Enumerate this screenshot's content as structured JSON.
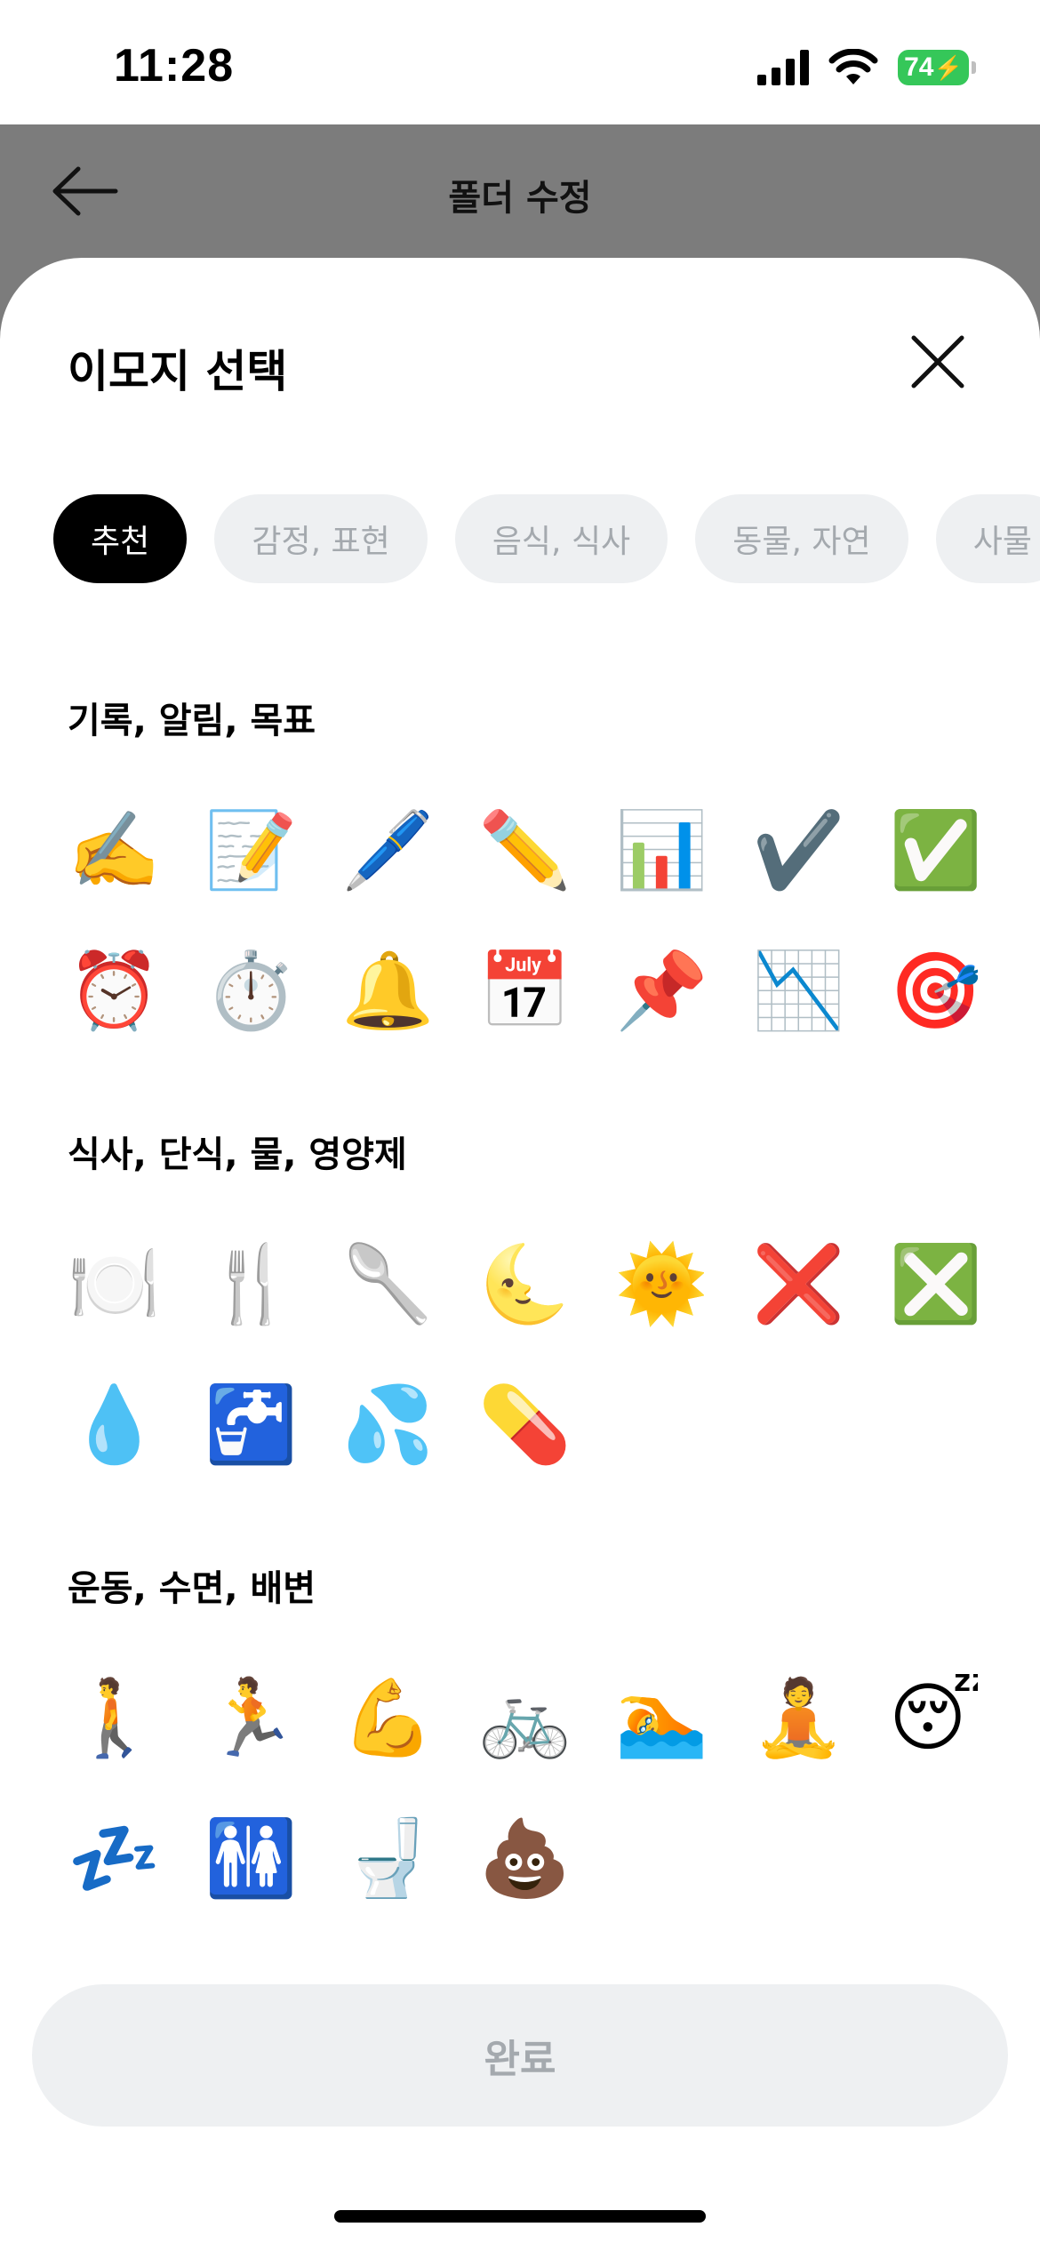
{
  "status_bar": {
    "time": "11:28",
    "battery": "74"
  },
  "header": {
    "title": "폴더 수정",
    "back_icon": "arrow-left-icon"
  },
  "sheet": {
    "title": "이모지 선택",
    "close_icon": "close-icon"
  },
  "chips": [
    {
      "label": "추천",
      "active": true
    },
    {
      "label": "감정, 표현",
      "active": false
    },
    {
      "label": "음식, 식사",
      "active": false
    },
    {
      "label": "동물, 자연",
      "active": false
    },
    {
      "label": "사물",
      "active": false
    }
  ],
  "sections": [
    {
      "title": "기록, 알림, 목표",
      "emojis": [
        "✍️",
        "📝",
        "🖊️",
        "✏️",
        "📊",
        "✔️",
        "✅",
        "⏰",
        "⏱️",
        "🔔",
        "📅",
        "📌",
        "📉",
        "🎯"
      ]
    },
    {
      "title": "식사, 단식, 물, 영양제",
      "emojis": [
        "🍽️",
        "🍴",
        "🥄",
        "🌜",
        "🌞",
        "❌",
        "❎",
        "💧",
        "🚰",
        "💦",
        "💊"
      ]
    },
    {
      "title": "운동, 수면, 배변",
      "emojis": [
        "🚶",
        "🏃",
        "💪",
        "🚲",
        "🏊",
        "🧘",
        "😴",
        "💤",
        "🚻",
        "🚽",
        "💩"
      ]
    }
  ],
  "done_button": {
    "label": "완료"
  },
  "colors": {
    "accent": "#000000",
    "chip_bg": "#eef0f2",
    "chip_text": "#a4a9ae",
    "overlay": "#7c7c7c",
    "battery": "#35c759"
  }
}
